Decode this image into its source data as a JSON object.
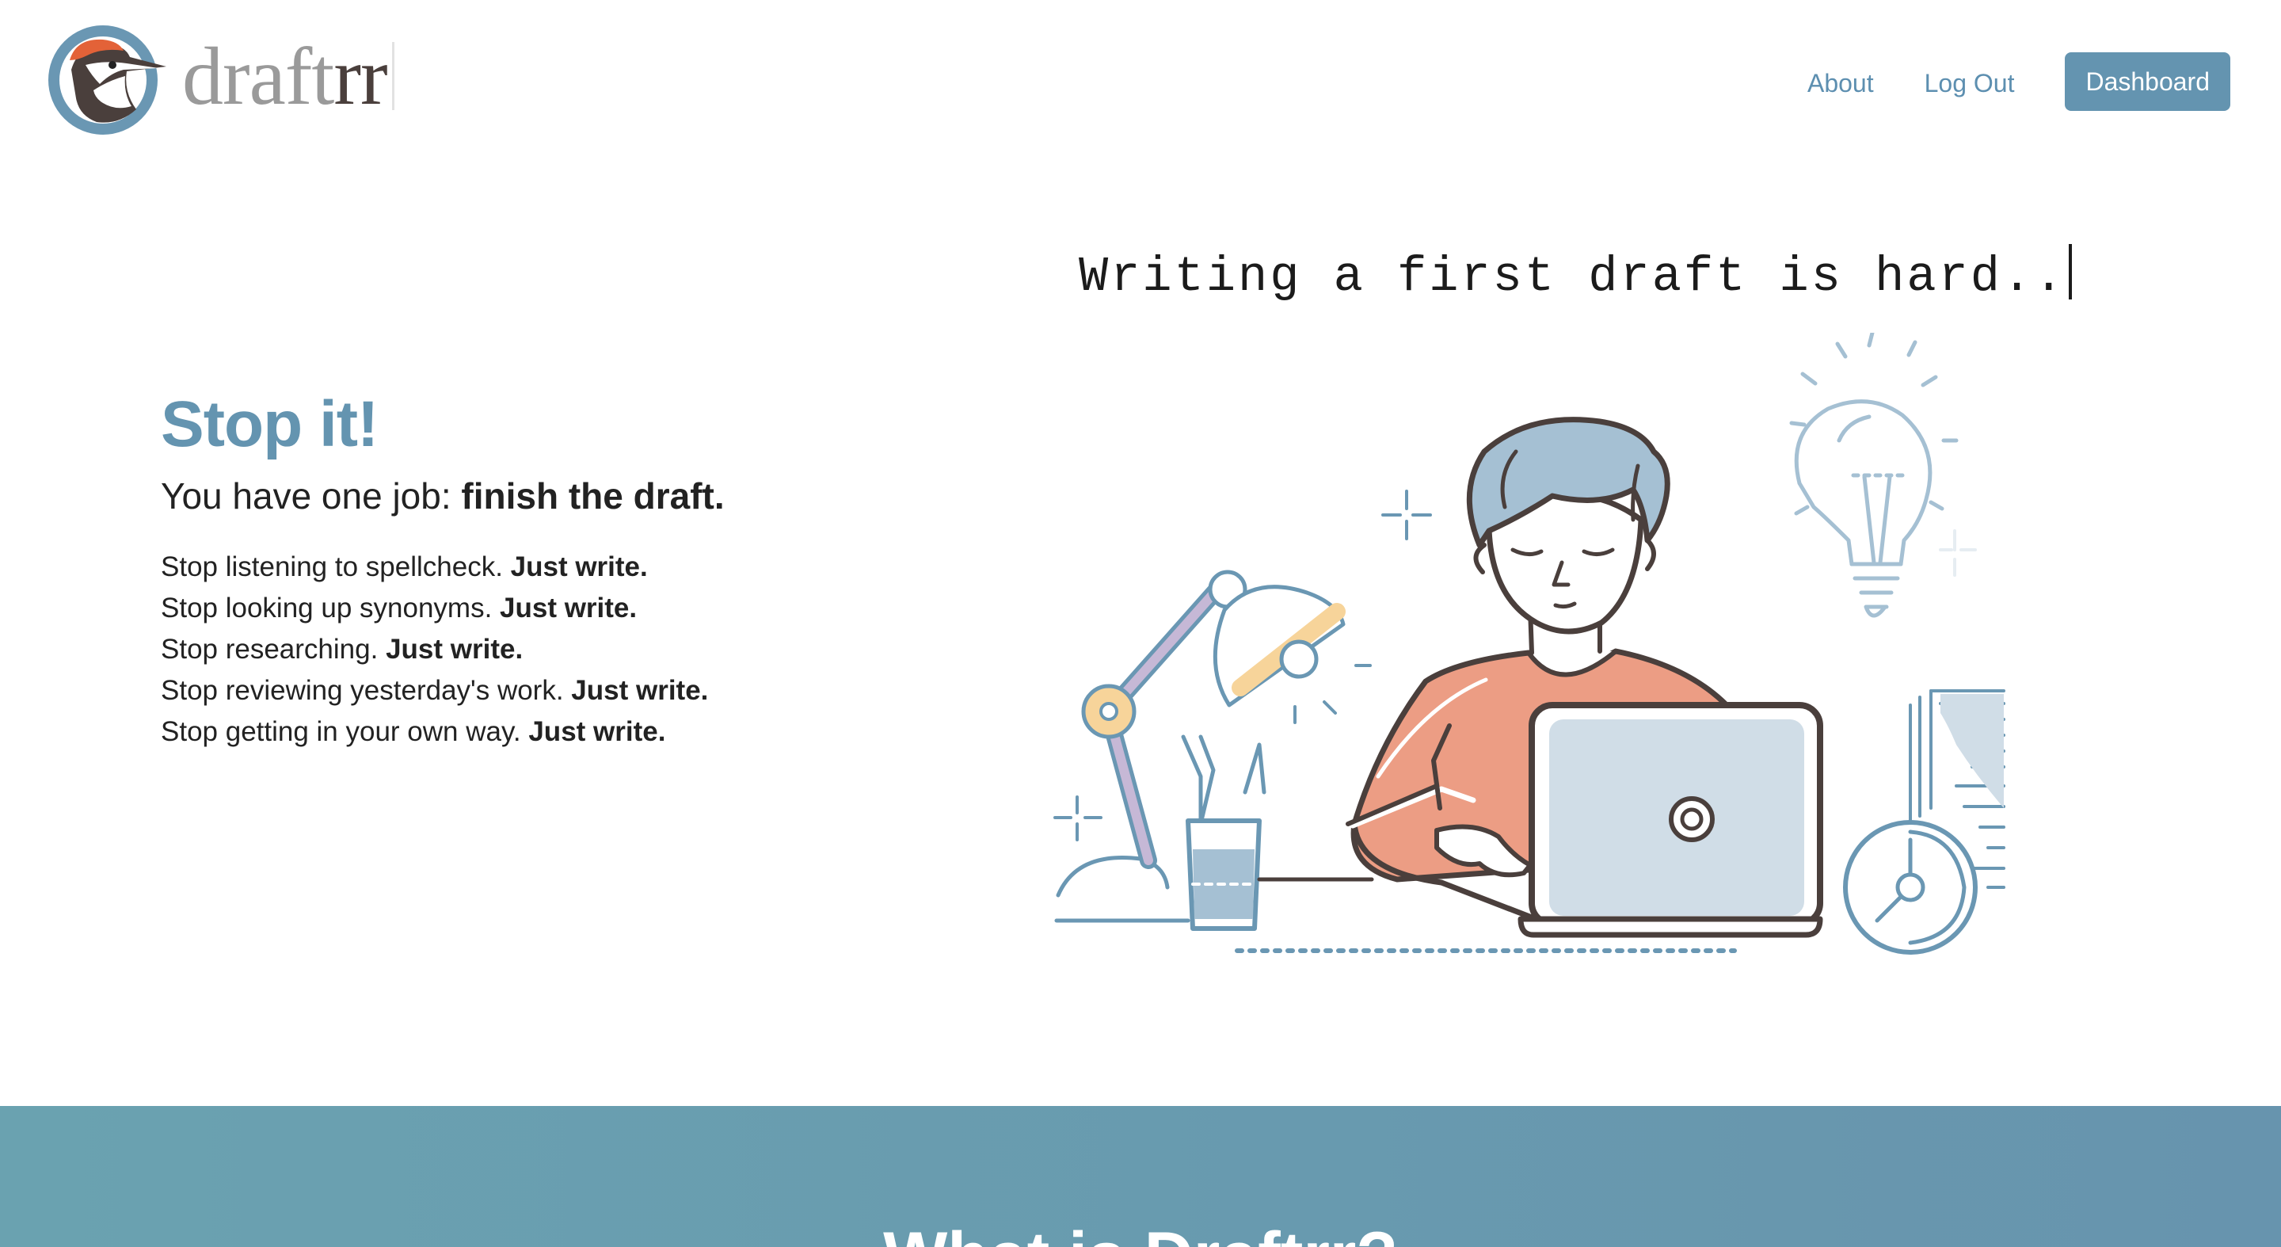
{
  "header": {
    "logo_text_a": "draft",
    "logo_text_b": "rr",
    "nav": {
      "about_label": "About",
      "logout_label": "Log Out",
      "dashboard_label": "Dashboard"
    }
  },
  "hero": {
    "typewriter_text": "Writing a first draft is hard..",
    "title": "Stop it!",
    "subtitle_prefix": "You have one job: ",
    "subtitle_bold": "finish the draft.",
    "items": [
      {
        "text": "Stop listening to spellcheck. ",
        "bold": "Just write."
      },
      {
        "text": "Stop looking up synonyms. ",
        "bold": "Just write."
      },
      {
        "text": "Stop researching. ",
        "bold": "Just write."
      },
      {
        "text": "Stop reviewing yesterday's work. ",
        "bold": "Just write."
      },
      {
        "text": "Stop getting in your own way. ",
        "bold": "Just write."
      }
    ]
  },
  "band": {
    "heading": "What is Draftrr?"
  },
  "icons": {
    "logo": "woodpecker-logo-icon",
    "illustration": "writer-at-laptop-illustration"
  },
  "colors": {
    "accent": "#6494b0",
    "band_start": "#6aa2b0",
    "band_end": "#6794ae",
    "shirt": "#ec9d84",
    "hair": "#a5c0d3",
    "outline": "#4a3f3c"
  }
}
